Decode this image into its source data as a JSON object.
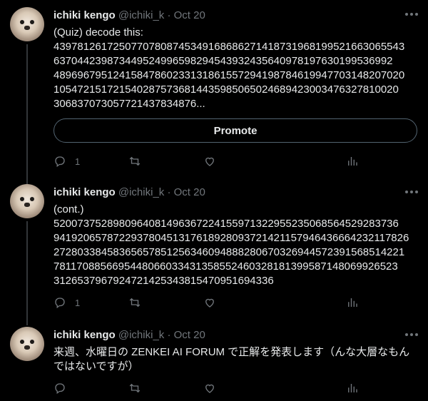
{
  "tweets": [
    {
      "author": {
        "name": "ichiki kengo",
        "handle": "@ichiki_k",
        "separator": "·",
        "date": "Oct 20"
      },
      "text_lines": [
        "(Quiz) decode this:",
        "43978126172507707808745349168686271418731968199521663065543",
        "63704423987344952499659829454393243564097819763019953699​2",
        "48969679512415847860233131861557294198784619947703148207020",
        "105472151721540287573681443598506502468942300347632781002​0",
        "30683707305772143783487​6..."
      ],
      "promote_label": "Promote",
      "actions": {
        "replies": "1",
        "retweets": "",
        "likes": "",
        "views": ""
      },
      "icons": {
        "more": "more-icon",
        "reply": "reply-icon",
        "retweet": "retweet-icon",
        "like": "like-icon",
        "analytics": "analytics-icon"
      }
    },
    {
      "author": {
        "name": "ichiki kengo",
        "handle": "@ichiki_k",
        "separator": "·",
        "date": "Oct 20"
      },
      "text_lines": [
        "(cont.)",
        "52007375289809640814963672241559713229552350685645292837​36",
        "94192065787229378045131761892809372142115794643666423211782​6",
        "27280338458365657851256346094888280670326944572391568514221",
        "78117088566954480660334313585524603281813995871480699265​23",
        "31265379679247214253438154709516943​36"
      ],
      "actions": {
        "replies": "1",
        "retweets": "",
        "likes": "",
        "views": ""
      }
    },
    {
      "author": {
        "name": "ichiki kengo",
        "handle": "@ichiki_k",
        "separator": "·",
        "date": "Oct 20"
      },
      "text_lines": [
        "来週、水曜日の ZENKEI AI FORUM で正解を発表します（んな大層なもん",
        "ではないですが）"
      ],
      "actions": {
        "replies": "",
        "retweets": "",
        "likes": "",
        "views": ""
      }
    }
  ],
  "colors": {
    "background": "#000000",
    "text": "#e7e9ea",
    "muted": "#71767b",
    "border": "#536471"
  }
}
